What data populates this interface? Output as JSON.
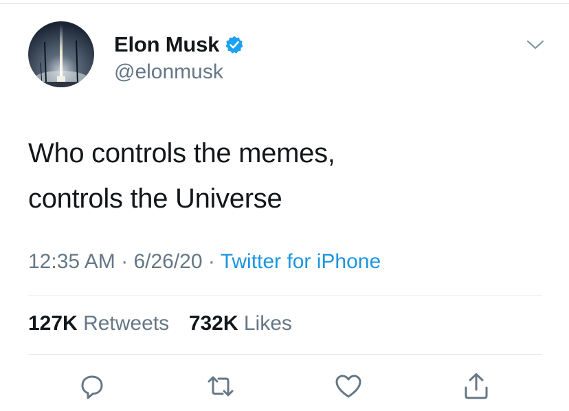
{
  "colors": {
    "text_primary": "#14171a",
    "text_secondary": "#657786",
    "link": "#1b95e0",
    "verified_badge": "#1da1f2",
    "divider": "#e1e8ed"
  },
  "author": {
    "display_name": "Elon Musk",
    "handle": "@elonmusk",
    "verified": true,
    "avatar_icon": "rocket-launch-avatar"
  },
  "tweet": {
    "text_lines": [
      "Who controls the memes,",
      "controls the Universe"
    ],
    "time": "12:35 AM",
    "date": "6/26/20",
    "separator": "·",
    "source": "Twitter for iPhone"
  },
  "stats": {
    "retweets_count": "127K",
    "retweets_label": "Retweets",
    "likes_count": "732K",
    "likes_label": "Likes"
  },
  "actions": [
    {
      "icon": "reply-icon"
    },
    {
      "icon": "retweet-icon"
    },
    {
      "icon": "like-icon"
    },
    {
      "icon": "share-icon"
    }
  ],
  "menu": {
    "icon": "chevron-down-icon"
  }
}
